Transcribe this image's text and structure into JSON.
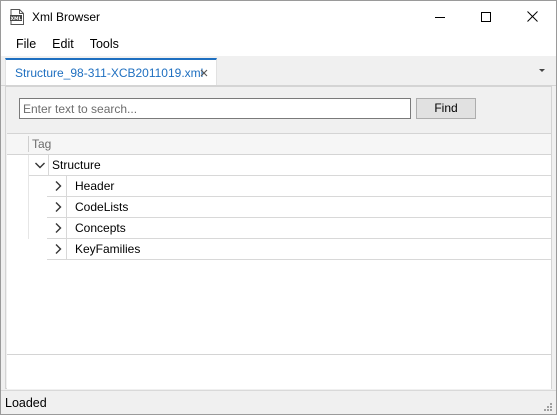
{
  "window": {
    "title": "Xml Browser",
    "app_icon_text": "XML"
  },
  "menu": {
    "items": [
      "File",
      "Edit",
      "Tools"
    ]
  },
  "tabs": {
    "active": {
      "label": "Structure_98-311-XCB2011019.xml"
    }
  },
  "search": {
    "placeholder": "Enter text to search...",
    "value": "",
    "find_label": "Find"
  },
  "tree": {
    "column_header": "Tag",
    "root": {
      "label": "Structure",
      "expanded": true
    },
    "children": [
      {
        "label": "Header",
        "expanded": false
      },
      {
        "label": "CodeLists",
        "expanded": false
      },
      {
        "label": "Concepts",
        "expanded": false
      },
      {
        "label": "KeyFamilies",
        "expanded": false
      }
    ]
  },
  "status": {
    "text": "Loaded"
  },
  "colors": {
    "accent": "#1e6fc0",
    "window_bg": "#f0f0f0",
    "row_border": "#d8d8d8"
  },
  "icons": {
    "app": "xml-file-icon",
    "minimize": "minimize-icon",
    "maximize": "maximize-icon",
    "close": "close-icon",
    "tab_close": "close-icon",
    "tab_menu": "chevron-down-icon",
    "expanded": "chevron-down-icon",
    "collapsed": "chevron-right-icon",
    "grip": "resize-grip-icon"
  }
}
